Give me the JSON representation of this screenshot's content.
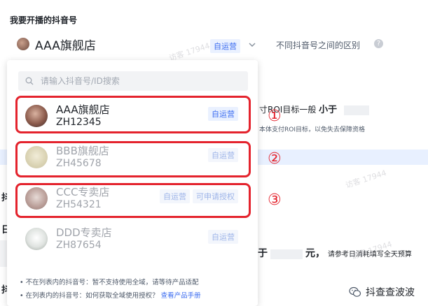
{
  "section": {
    "title": "我要开播的抖音号"
  },
  "selector": {
    "name": "AAA旗舰店",
    "tag": "自运营"
  },
  "diff_link": "不同抖音号之间的区别",
  "background": {
    "roi_text": "寸ROI目标一般",
    "roi_bold": "小于",
    "roi_sub": "本体支付ROI目标，以免失去保障资格",
    "budget_prefix": "于",
    "budget_unit": "元，",
    "budget_hint": "请参考日消耗填写全天预算",
    "left_chars": [
      "抖",
      "日",
      "抖"
    ]
  },
  "dropdown": {
    "search_placeholder": "请输入抖音号/ID搜索",
    "items": [
      {
        "name": "AAA旗舰店",
        "id": "ZH12345",
        "tags": [
          "自运营"
        ],
        "state": "active"
      },
      {
        "name": "BBB旗舰店",
        "id": "ZH45678",
        "tags": [
          "自运营"
        ],
        "state": "disabled"
      },
      {
        "name": "CCC专卖店",
        "id": "ZH54321",
        "tags": [
          "自运营",
          "可申请授权"
        ],
        "state": "disabled"
      },
      {
        "name": "DDD专卖店",
        "id": "ZH87654",
        "tags": [
          "自运营"
        ],
        "state": "disabled"
      }
    ],
    "footnotes": [
      {
        "text": "• 不在列表内的抖音号：暂不支持使用全域，请等待产品适配",
        "link": ""
      },
      {
        "text": "• 在列表内的抖音号：如何获取全域使用授权？",
        "link": "查看产品手册"
      }
    ]
  },
  "annotations": [
    "①",
    "②",
    "③"
  ],
  "watermark": "访客 17944",
  "brand": {
    "name": "抖查查波波"
  },
  "colors": {
    "accent": "#3c6df0",
    "annotation": "#e4232d",
    "tag_bg": "#eaf1ff"
  },
  "icons": {
    "search": "search-icon",
    "chevron": "chevron-down-icon",
    "help": "help-icon",
    "brand": "wechat-icon"
  }
}
